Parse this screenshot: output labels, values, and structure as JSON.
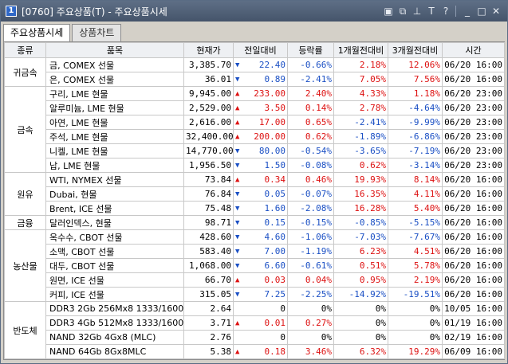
{
  "window": {
    "icon_label": "1",
    "title": "[0760] 주요상품(T) - 주요상품시세",
    "tools": [
      "layout-icon",
      "copy-icon",
      "pin-icon",
      "font-icon",
      "help-icon",
      "minimize-icon",
      "maximize-icon",
      "close-icon"
    ]
  },
  "tabs": [
    {
      "label": "주요상품시세",
      "active": true
    },
    {
      "label": "상품차트",
      "active": false
    }
  ],
  "columns": [
    "종류",
    "품목",
    "현재가",
    "전일대비",
    "등락률",
    "1개월전대비",
    "3개월전대비",
    "시간"
  ],
  "colors": {
    "up": "#d11111",
    "down": "#1a4fc4"
  },
  "groups": [
    {
      "category": "귀금속",
      "rows": [
        {
          "name": "금, COMEX 선물",
          "price": "3,385.70",
          "dir": "down",
          "change": "22.40",
          "rate": "-0.66%",
          "m1": "2.18%",
          "m3": "12.06%",
          "time": "06/20 16:00"
        },
        {
          "name": "은, COMEX 선물",
          "price": "36.01",
          "dir": "down",
          "change": "0.89",
          "rate": "-2.41%",
          "m1": "7.05%",
          "m3": "7.56%",
          "time": "06/20 16:00"
        }
      ]
    },
    {
      "category": "금속",
      "rows": [
        {
          "name": "구리, LME 현물",
          "price": "9,945.00",
          "dir": "up",
          "change": "233.00",
          "rate": "2.40%",
          "m1": "4.33%",
          "m3": "1.18%",
          "time": "06/20 23:00"
        },
        {
          "name": "알루미늄, LME 현물",
          "price": "2,529.00",
          "dir": "up",
          "change": "3.50",
          "rate": "0.14%",
          "m1": "2.78%",
          "m3": "-4.64%",
          "time": "06/20 23:00"
        },
        {
          "name": "아연, LME 현물",
          "price": "2,616.00",
          "dir": "up",
          "change": "17.00",
          "rate": "0.65%",
          "m1": "-2.41%",
          "m3": "-9.99%",
          "time": "06/20 23:00"
        },
        {
          "name": "주석, LME 현물",
          "price": "32,400.00",
          "dir": "up",
          "change": "200.00",
          "rate": "0.62%",
          "m1": "-1.89%",
          "m3": "-6.86%",
          "time": "06/20 23:00"
        },
        {
          "name": "니켈, LME 현물",
          "price": "14,770.00",
          "dir": "down",
          "change": "80.00",
          "rate": "-0.54%",
          "m1": "-3.65%",
          "m3": "-7.19%",
          "time": "06/20 23:00"
        },
        {
          "name": "납, LME 현물",
          "price": "1,956.50",
          "dir": "down",
          "change": "1.50",
          "rate": "-0.08%",
          "m1": "0.62%",
          "m3": "-3.14%",
          "time": "06/20 23:00"
        }
      ]
    },
    {
      "category": "원유",
      "rows": [
        {
          "name": "WTI, NYMEX 선물",
          "price": "73.84",
          "dir": "up",
          "change": "0.34",
          "rate": "0.46%",
          "m1": "19.93%",
          "m3": "8.14%",
          "time": "06/20 16:00"
        },
        {
          "name": "Dubai, 현물",
          "price": "76.84",
          "dir": "down",
          "change": "0.05",
          "rate": "-0.07%",
          "m1": "16.35%",
          "m3": "4.11%",
          "time": "06/20 16:00"
        },
        {
          "name": "Brent, ICE 선물",
          "price": "75.48",
          "dir": "down",
          "change": "1.60",
          "rate": "-2.08%",
          "m1": "16.28%",
          "m3": "5.40%",
          "time": "06/20 16:00"
        }
      ]
    },
    {
      "category": "금융",
      "rows": [
        {
          "name": "달러인덱스, 현물",
          "price": "98.71",
          "dir": "down",
          "change": "0.15",
          "rate": "-0.15%",
          "m1": "-0.85%",
          "m3": "-5.15%",
          "time": "06/20 16:00"
        }
      ]
    },
    {
      "category": "농산물",
      "rows": [
        {
          "name": "옥수수, CBOT 선물",
          "price": "428.60",
          "dir": "down",
          "change": "4.60",
          "rate": "-1.06%",
          "m1": "-7.03%",
          "m3": "-7.67%",
          "time": "06/20 16:00"
        },
        {
          "name": "소맥, CBOT 선물",
          "price": "583.40",
          "dir": "down",
          "change": "7.00",
          "rate": "-1.19%",
          "m1": "6.23%",
          "m3": "4.51%",
          "time": "06/20 16:00"
        },
        {
          "name": "대두, CBOT 선물",
          "price": "1,068.00",
          "dir": "down",
          "change": "6.60",
          "rate": "-0.61%",
          "m1": "0.51%",
          "m3": "5.78%",
          "time": "06/20 16:00"
        },
        {
          "name": "원면, ICE 선물",
          "price": "66.70",
          "dir": "up",
          "change": "0.03",
          "rate": "0.04%",
          "m1": "0.95%",
          "m3": "2.19%",
          "time": "06/20 16:00"
        },
        {
          "name": "커피, ICE 선물",
          "price": "315.05",
          "dir": "down",
          "change": "7.25",
          "rate": "-2.25%",
          "m1": "-14.92%",
          "m3": "-19.51%",
          "time": "06/20 16:00"
        }
      ]
    },
    {
      "category": "반도체",
      "rows": [
        {
          "name": "DDR3 2Gb 256Mx8 1333/1600MH",
          "price": "2.64",
          "dir": "flat",
          "change": "0",
          "rate": "0%",
          "m1": "0%",
          "m3": "0%",
          "time": "10/05 16:00"
        },
        {
          "name": "DDR3 4Gb 512Mx8 1333/1600MH",
          "price": "3.71",
          "dir": "up",
          "change": "0.01",
          "rate": "0.27%",
          "m1": "0%",
          "m3": "0%",
          "time": "01/19 16:00"
        },
        {
          "name": "NAND 32Gb 4Gx8 (MLC)",
          "price": "2.76",
          "dir": "flat",
          "change": "0",
          "rate": "0%",
          "m1": "0%",
          "m3": "0%",
          "time": "02/19 16:00"
        },
        {
          "name": "NAND 64Gb 8Gx8MLC",
          "price": "5.38",
          "dir": "up",
          "change": "0.18",
          "rate": "3.46%",
          "m1": "6.32%",
          "m3": "19.29%",
          "time": "06/09 16:00"
        }
      ]
    }
  ]
}
